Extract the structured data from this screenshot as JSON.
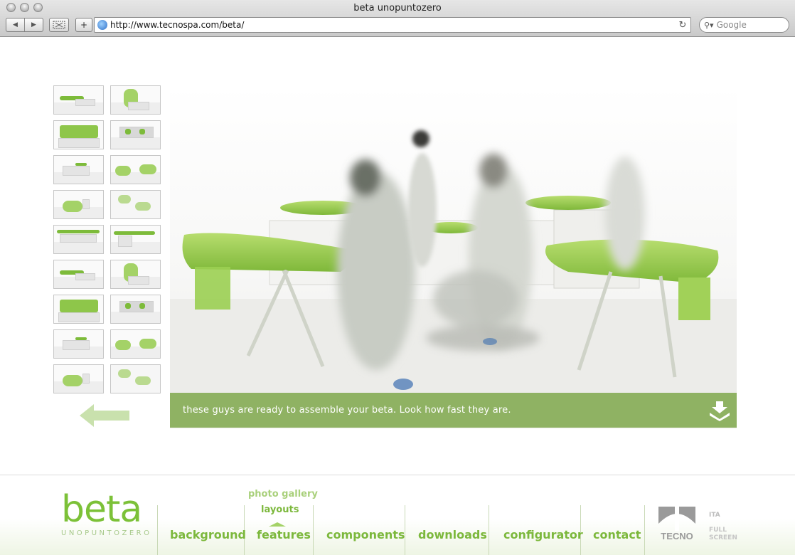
{
  "window": {
    "title": "beta unopuntozero"
  },
  "browser": {
    "url": "http://www.tecnospa.com/beta/",
    "search_placeholder": "Google",
    "back_icon": "◀",
    "forward_icon": "▶",
    "add_icon": "+",
    "reload_icon": "↻"
  },
  "gallery": {
    "caption": "these guys are ready to assemble your beta. Look how fast they are.",
    "thumbnail_count": 18
  },
  "logo": {
    "word": "beta",
    "subtitle": "UNOPUNTOZERO"
  },
  "subnav": {
    "items": [
      "photo gallery",
      "layouts"
    ],
    "active": "layouts"
  },
  "nav": {
    "items": [
      "background",
      "features",
      "components",
      "downloads",
      "configurator",
      "contact"
    ]
  },
  "brand": {
    "name": "TECNO"
  },
  "lang": {
    "label": "ITA"
  },
  "fullscreen": {
    "line1": "FULL",
    "line2": "SCREEN"
  },
  "colors": {
    "accent": "#7cb83c",
    "light_accent": "#a9d07b",
    "caption_bg": "#82aa50"
  }
}
